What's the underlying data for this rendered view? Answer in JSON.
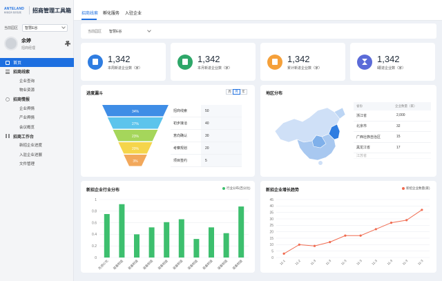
{
  "brand": {
    "logo_line1": "ANTELAND",
    "logo_line2": "精准招商 数智赋能",
    "title": "招商管理工具箱"
  },
  "sidebar": {
    "region_label": "当前园区",
    "region_value": "智慧E谷",
    "user": {
      "name": "余婷",
      "role": "招商经理"
    },
    "items": [
      {
        "label": "首页",
        "active": true
      },
      {
        "label": "招商线索",
        "group": true
      },
      {
        "label": "企业查询"
      },
      {
        "label": "物业资源"
      },
      {
        "label": "招商情报",
        "group": true
      },
      {
        "label": "企业舆情"
      },
      {
        "label": "产业舆情"
      },
      {
        "label": "会议概览"
      },
      {
        "label": "招商工作台",
        "group": true
      },
      {
        "label": "新招企业进度"
      },
      {
        "label": "入驻企业进展"
      },
      {
        "label": "文件管理"
      }
    ]
  },
  "tabs": [
    {
      "label": "招商线索",
      "active": true
    },
    {
      "label": "孵化服务"
    },
    {
      "label": "入驻企业"
    }
  ],
  "filter": {
    "label": "当前园区",
    "value": "智慧E谷"
  },
  "stats": [
    {
      "value": "1,342",
      "label": "本周新进企业数（家）",
      "color": "#2f7de1"
    },
    {
      "value": "1,342",
      "label": "本月新进企业数（家）",
      "color": "#2ea769"
    },
    {
      "value": "1,342",
      "label": "累计新进企业数（家）",
      "color": "#f5a03a"
    },
    {
      "value": "1,342",
      "label": "l跟进企业数（家）",
      "color": "#5b6bd8"
    }
  ],
  "funnel": {
    "title": "进度漏斗",
    "periods": [
      "周",
      "月",
      "年"
    ],
    "active_period": "月",
    "stages": [
      {
        "pct": "34%",
        "name": "招商线索",
        "value": "50",
        "color": "#3f8de6"
      },
      {
        "pct": "27%",
        "name": "初步接洽",
        "value": "40",
        "color": "#5cc4ec"
      },
      {
        "pct": "23%",
        "name": "意向确认",
        "value": "30",
        "color": "#a5d65b"
      },
      {
        "pct": "20%",
        "name": "考察规划",
        "value": "20",
        "color": "#f5d54b"
      },
      {
        "pct": "3%",
        "name": "项目签约",
        "value": "5",
        "color": "#f2a85b"
      }
    ]
  },
  "region": {
    "title": "地区分布",
    "headers": [
      "省份",
      "企业数量（家）"
    ],
    "rows": [
      {
        "name": "浙江省",
        "value": "2,000"
      },
      {
        "name": "北京市",
        "value": "32"
      },
      {
        "name": "广西壮族自治区",
        "value": "15"
      },
      {
        "name": "黑龙江省",
        "value": "17"
      },
      {
        "name": "江苏省",
        "value": ""
      }
    ]
  },
  "industry": {
    "title": "新招企业行业分布",
    "legend": "行业分布(百分比)",
    "color": "#3dbf6e",
    "chart_data": {
      "type": "bar",
      "categories": [
        "先进IC化",
        "装备制造",
        "装备制造",
        "装备制造",
        "装备制造",
        "装备制造",
        "装备制造",
        "装备制造",
        "装备制造",
        "装备制造"
      ],
      "values": [
        0.75,
        0.92,
        0.4,
        0.52,
        0.61,
        0.66,
        0.32,
        0.52,
        0.42,
        0.88
      ],
      "yticks": [
        "0",
        "0.2",
        "0.4",
        "0.6",
        "0.8",
        "1"
      ],
      "ylim": [
        0,
        1
      ]
    }
  },
  "trend": {
    "title": "新招企业增长趋势",
    "legend": "新招企业数量(家)",
    "color": "#f06b50",
    "chart_data": {
      "type": "line",
      "categories": [
        "11-1",
        "11-2",
        "11-3",
        "11-3",
        "11-3",
        "11-3",
        "11-3",
        "11-3",
        "11-3",
        "11-3"
      ],
      "values": [
        3,
        10,
        9,
        12,
        17,
        17,
        22,
        27,
        29,
        37
      ],
      "yticks": [
        "0",
        "5",
        "10",
        "15",
        "20",
        "25",
        "30",
        "35",
        "40",
        "45"
      ],
      "ylim": [
        0,
        45
      ]
    }
  }
}
